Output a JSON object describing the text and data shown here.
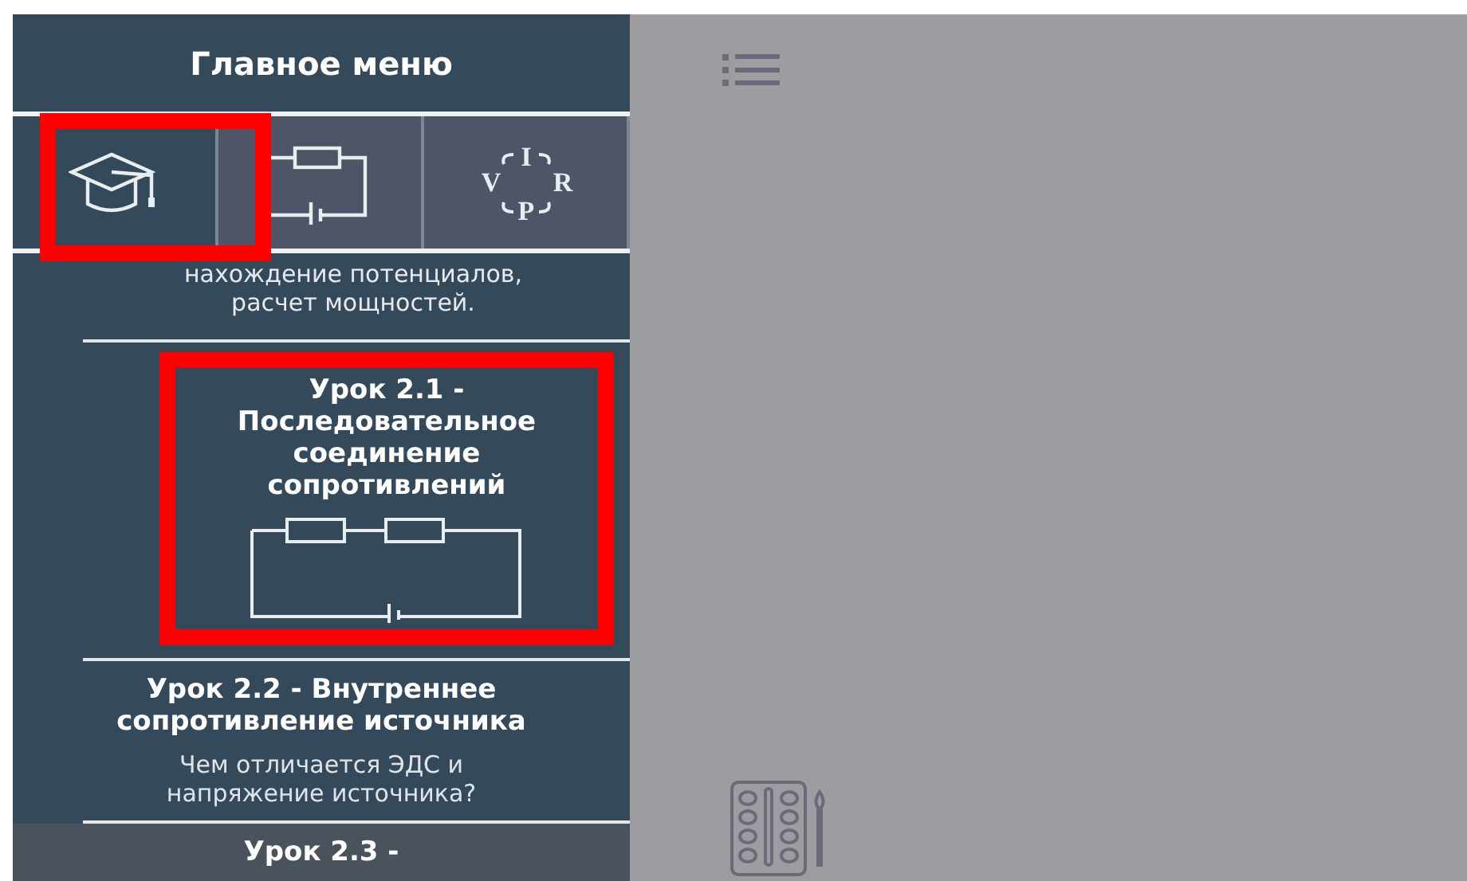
{
  "sidebar": {
    "title": "Главное меню",
    "tabs": [
      {
        "kind": "cap",
        "selected": true,
        "highlighted": true
      },
      {
        "kind": "circuit",
        "selected": false,
        "highlighted": false
      },
      {
        "kind": "formula",
        "selected": false,
        "highlighted": false,
        "letters": [
          "I",
          "V",
          "R",
          "P"
        ]
      }
    ],
    "intro_text": "нахождение потенциалов,\nрасчет мощностей.",
    "lessons": [
      {
        "kind": "diagram",
        "title": "Урок 2.1 -\nПоследовательное\nсоединение\nсопротивлений",
        "highlighted": true,
        "shaded": false
      },
      {
        "kind": "text",
        "title": "Урок 2.2 - Внутреннее\nсопротивление источника",
        "description": "Чем отличается ЭДС и\nнапряжение источника?",
        "highlighted": false,
        "shaded": false
      },
      {
        "kind": "text",
        "title": "Урок 2.3 -",
        "highlighted": false,
        "shaded": true
      }
    ]
  },
  "workspace": {
    "tools": [
      {
        "kind": "list"
      },
      {
        "kind": "palette"
      }
    ]
  }
}
